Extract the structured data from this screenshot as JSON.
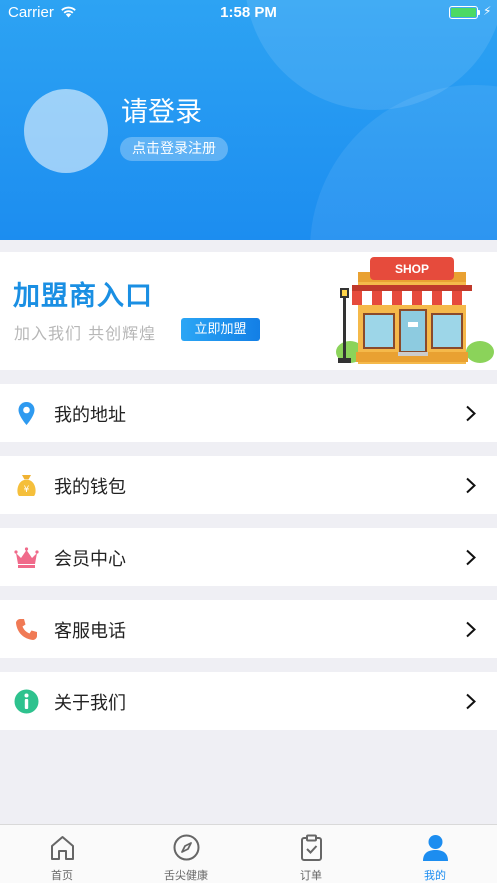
{
  "status_bar": {
    "carrier": "Carrier",
    "time": "1:58 PM"
  },
  "profile": {
    "title": "请登录",
    "login_register": "点击登录注册"
  },
  "banner": {
    "title": "加盟商入口",
    "subtitle": "加入我们 共创辉煌",
    "join_button": "立即加盟",
    "shop_sign": "SHOP"
  },
  "menu": [
    {
      "label": "我的地址",
      "icon": "location-pin-icon"
    },
    {
      "label": "我的钱包",
      "icon": "money-bag-icon"
    },
    {
      "label": "会员中心",
      "icon": "crown-icon"
    },
    {
      "label": "客服电话",
      "icon": "phone-icon"
    },
    {
      "label": "关于我们",
      "icon": "info-icon"
    }
  ],
  "tabs": [
    {
      "label": "首页",
      "icon": "home-icon"
    },
    {
      "label": "舌尖健康",
      "icon": "compass-icon"
    },
    {
      "label": "订单",
      "icon": "clipboard-icon"
    },
    {
      "label": "我的",
      "icon": "user-icon",
      "active": true
    }
  ],
  "colors": {
    "primary": "#1c8df0",
    "background": "#efeff4"
  }
}
